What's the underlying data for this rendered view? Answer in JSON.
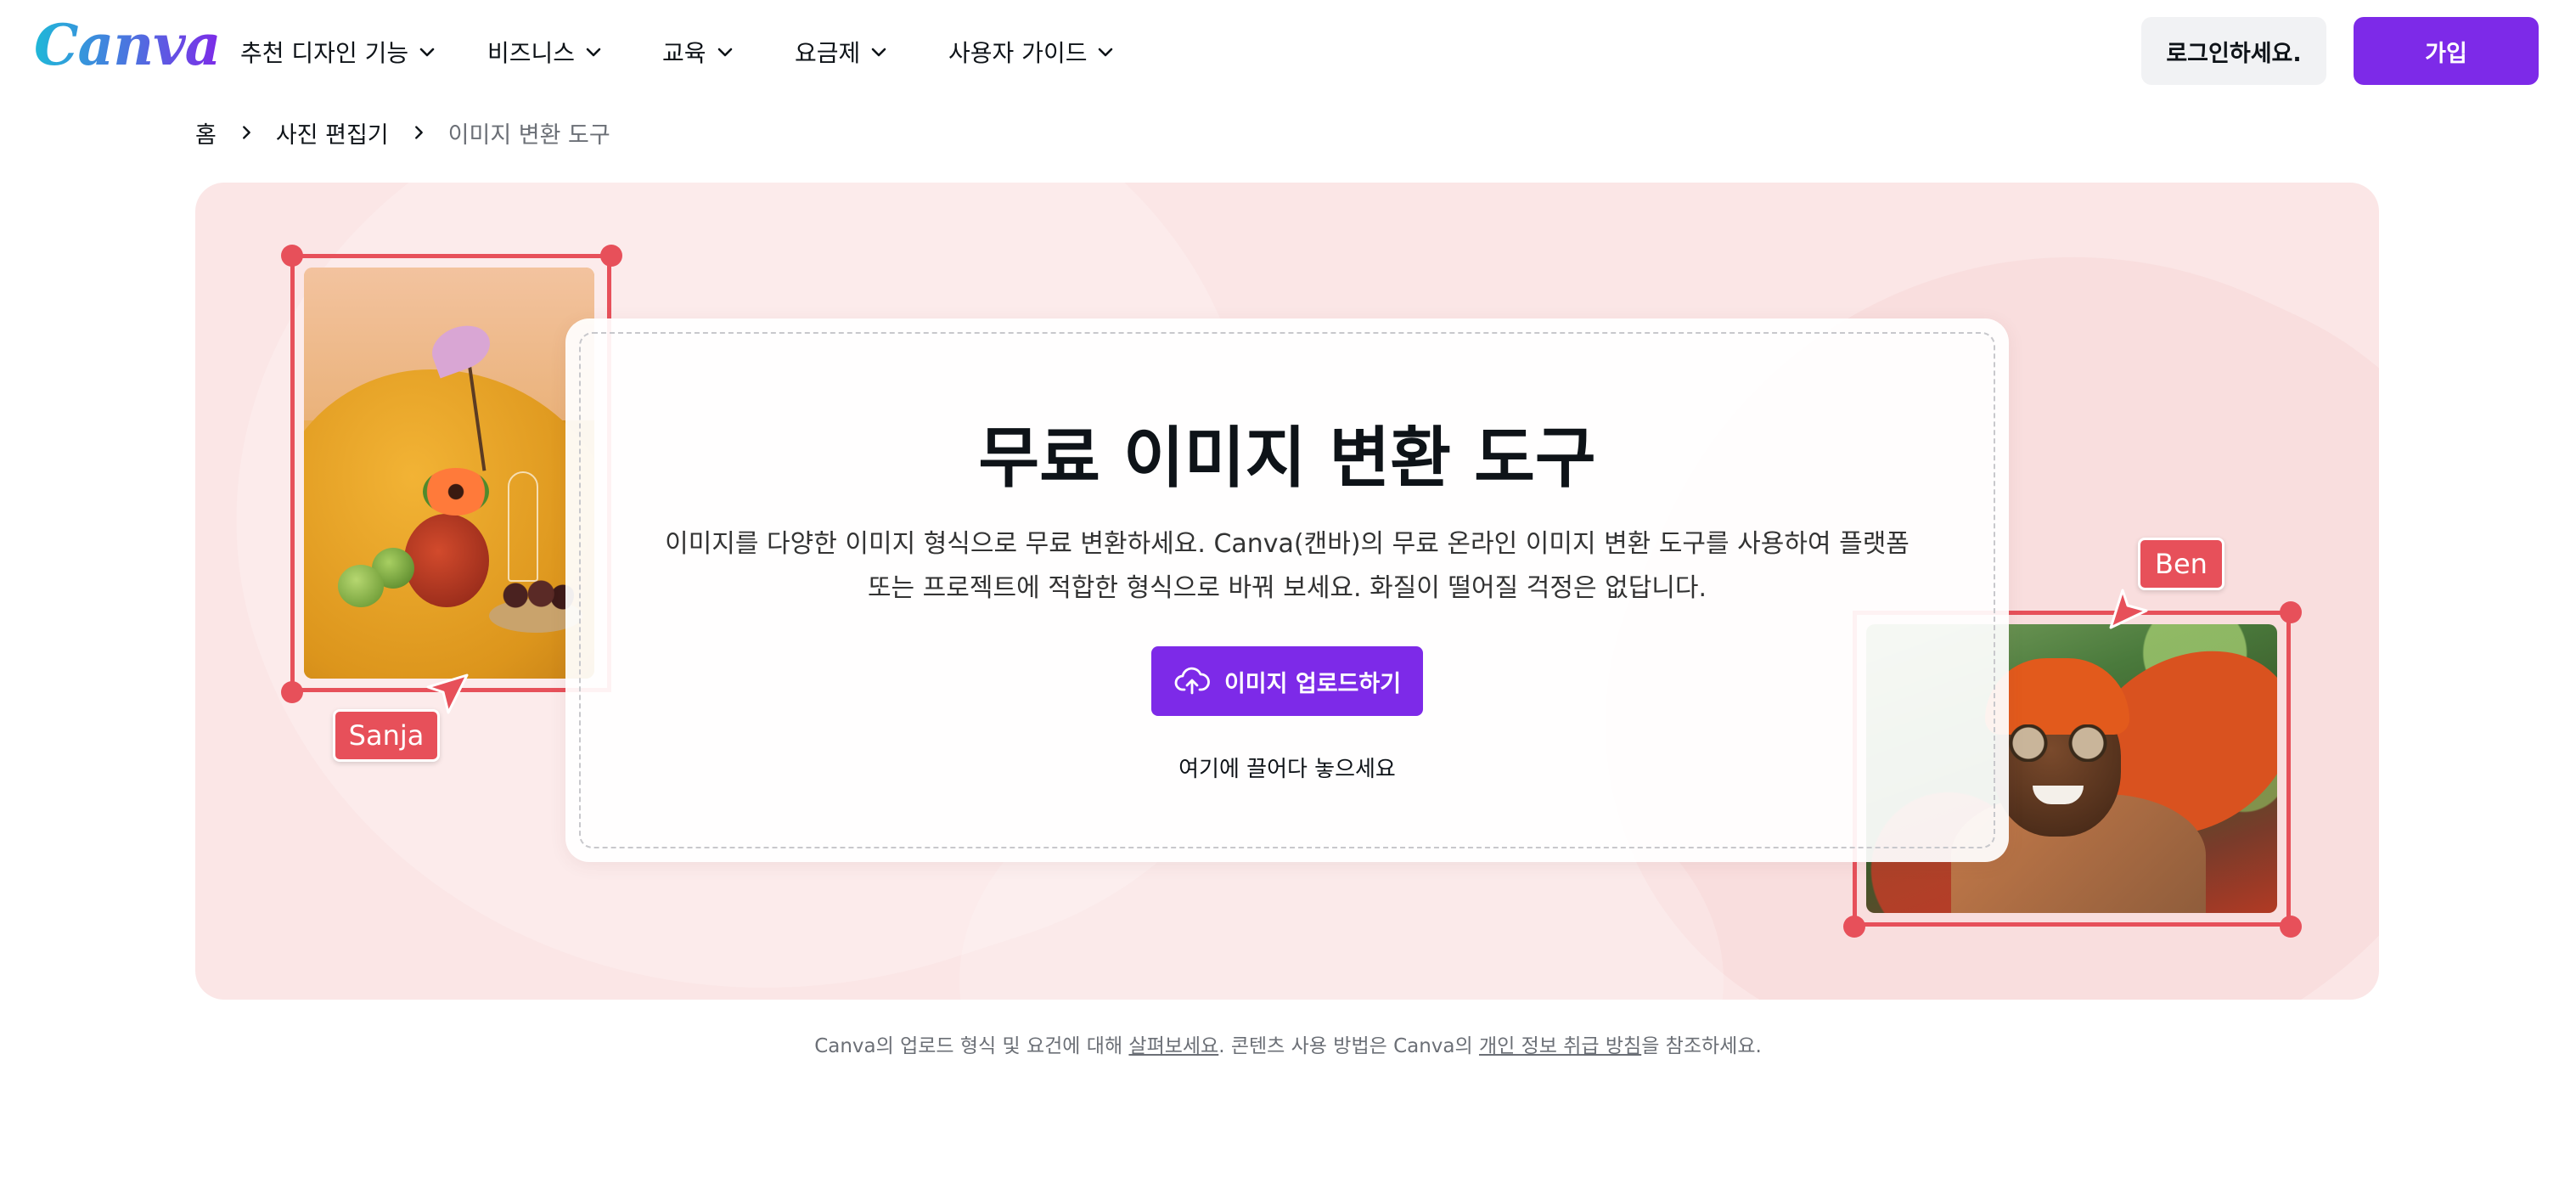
{
  "header": {
    "logo": "Canva",
    "nav": [
      {
        "label": "추천 디자인 기능"
      },
      {
        "label": "비즈니스"
      },
      {
        "label": "교육"
      },
      {
        "label": "요금제"
      },
      {
        "label": "사용자 가이드"
      }
    ],
    "login_label": "로그인하세요.",
    "signup_label": "가입"
  },
  "breadcrumb": {
    "items": [
      "홈",
      "사진 편집기",
      "이미지 변환 도구"
    ]
  },
  "hero": {
    "title": "무료 이미지 변환 도구",
    "description_line1": "이미지를 다양한 이미지 형식으로 무료 변환하세요. Canva(캔바)의 무료 온라인 이미지 변환 도구를 사용하여 플랫폼",
    "description_line2": "또는 프로젝트에 적합한 형식으로 바꿔 보세요. 화질이 떨어질 걱정은 없답니다.",
    "upload_label": "이미지 업로드하기",
    "drop_hint": "여기에 끌어다 놓으세요",
    "collaborator_left": "Sanja",
    "collaborator_right": "Ben",
    "accent_color": "#7d2ae8",
    "cursor_color": "#e7505a"
  },
  "footnote": {
    "prefix": "Canva의 업로드 형식 및 요건에 대해 ",
    "link1": "살펴보세요",
    "middle": ". 콘텐츠 사용 방법은 Canva의 ",
    "link2": "개인 정보 취급 방침",
    "suffix": "을 참조하세요."
  }
}
